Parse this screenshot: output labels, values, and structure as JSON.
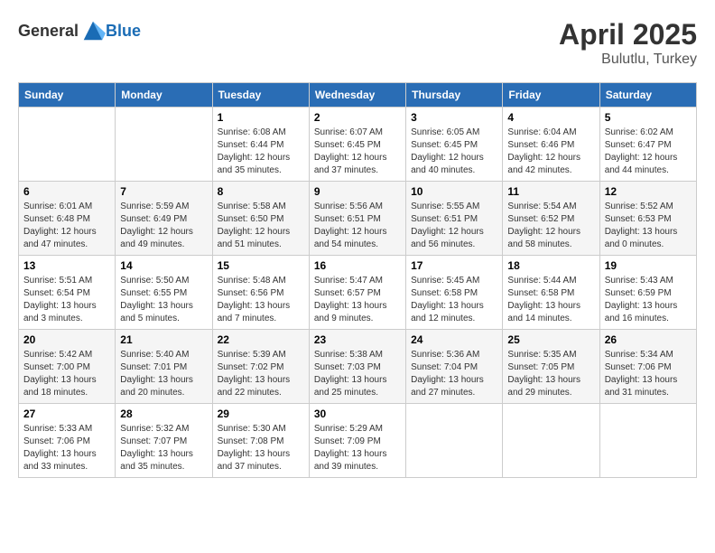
{
  "header": {
    "logo_general": "General",
    "logo_blue": "Blue",
    "title": "April 2025",
    "location": "Bulutlu, Turkey"
  },
  "days_of_week": [
    "Sunday",
    "Monday",
    "Tuesday",
    "Wednesday",
    "Thursday",
    "Friday",
    "Saturday"
  ],
  "weeks": [
    [
      {
        "num": "",
        "info": ""
      },
      {
        "num": "",
        "info": ""
      },
      {
        "num": "1",
        "info": "Sunrise: 6:08 AM\nSunset: 6:44 PM\nDaylight: 12 hours and 35 minutes."
      },
      {
        "num": "2",
        "info": "Sunrise: 6:07 AM\nSunset: 6:45 PM\nDaylight: 12 hours and 37 minutes."
      },
      {
        "num": "3",
        "info": "Sunrise: 6:05 AM\nSunset: 6:45 PM\nDaylight: 12 hours and 40 minutes."
      },
      {
        "num": "4",
        "info": "Sunrise: 6:04 AM\nSunset: 6:46 PM\nDaylight: 12 hours and 42 minutes."
      },
      {
        "num": "5",
        "info": "Sunrise: 6:02 AM\nSunset: 6:47 PM\nDaylight: 12 hours and 44 minutes."
      }
    ],
    [
      {
        "num": "6",
        "info": "Sunrise: 6:01 AM\nSunset: 6:48 PM\nDaylight: 12 hours and 47 minutes."
      },
      {
        "num": "7",
        "info": "Sunrise: 5:59 AM\nSunset: 6:49 PM\nDaylight: 12 hours and 49 minutes."
      },
      {
        "num": "8",
        "info": "Sunrise: 5:58 AM\nSunset: 6:50 PM\nDaylight: 12 hours and 51 minutes."
      },
      {
        "num": "9",
        "info": "Sunrise: 5:56 AM\nSunset: 6:51 PM\nDaylight: 12 hours and 54 minutes."
      },
      {
        "num": "10",
        "info": "Sunrise: 5:55 AM\nSunset: 6:51 PM\nDaylight: 12 hours and 56 minutes."
      },
      {
        "num": "11",
        "info": "Sunrise: 5:54 AM\nSunset: 6:52 PM\nDaylight: 12 hours and 58 minutes."
      },
      {
        "num": "12",
        "info": "Sunrise: 5:52 AM\nSunset: 6:53 PM\nDaylight: 13 hours and 0 minutes."
      }
    ],
    [
      {
        "num": "13",
        "info": "Sunrise: 5:51 AM\nSunset: 6:54 PM\nDaylight: 13 hours and 3 minutes."
      },
      {
        "num": "14",
        "info": "Sunrise: 5:50 AM\nSunset: 6:55 PM\nDaylight: 13 hours and 5 minutes."
      },
      {
        "num": "15",
        "info": "Sunrise: 5:48 AM\nSunset: 6:56 PM\nDaylight: 13 hours and 7 minutes."
      },
      {
        "num": "16",
        "info": "Sunrise: 5:47 AM\nSunset: 6:57 PM\nDaylight: 13 hours and 9 minutes."
      },
      {
        "num": "17",
        "info": "Sunrise: 5:45 AM\nSunset: 6:58 PM\nDaylight: 13 hours and 12 minutes."
      },
      {
        "num": "18",
        "info": "Sunrise: 5:44 AM\nSunset: 6:58 PM\nDaylight: 13 hours and 14 minutes."
      },
      {
        "num": "19",
        "info": "Sunrise: 5:43 AM\nSunset: 6:59 PM\nDaylight: 13 hours and 16 minutes."
      }
    ],
    [
      {
        "num": "20",
        "info": "Sunrise: 5:42 AM\nSunset: 7:00 PM\nDaylight: 13 hours and 18 minutes."
      },
      {
        "num": "21",
        "info": "Sunrise: 5:40 AM\nSunset: 7:01 PM\nDaylight: 13 hours and 20 minutes."
      },
      {
        "num": "22",
        "info": "Sunrise: 5:39 AM\nSunset: 7:02 PM\nDaylight: 13 hours and 22 minutes."
      },
      {
        "num": "23",
        "info": "Sunrise: 5:38 AM\nSunset: 7:03 PM\nDaylight: 13 hours and 25 minutes."
      },
      {
        "num": "24",
        "info": "Sunrise: 5:36 AM\nSunset: 7:04 PM\nDaylight: 13 hours and 27 minutes."
      },
      {
        "num": "25",
        "info": "Sunrise: 5:35 AM\nSunset: 7:05 PM\nDaylight: 13 hours and 29 minutes."
      },
      {
        "num": "26",
        "info": "Sunrise: 5:34 AM\nSunset: 7:06 PM\nDaylight: 13 hours and 31 minutes."
      }
    ],
    [
      {
        "num": "27",
        "info": "Sunrise: 5:33 AM\nSunset: 7:06 PM\nDaylight: 13 hours and 33 minutes."
      },
      {
        "num": "28",
        "info": "Sunrise: 5:32 AM\nSunset: 7:07 PM\nDaylight: 13 hours and 35 minutes."
      },
      {
        "num": "29",
        "info": "Sunrise: 5:30 AM\nSunset: 7:08 PM\nDaylight: 13 hours and 37 minutes."
      },
      {
        "num": "30",
        "info": "Sunrise: 5:29 AM\nSunset: 7:09 PM\nDaylight: 13 hours and 39 minutes."
      },
      {
        "num": "",
        "info": ""
      },
      {
        "num": "",
        "info": ""
      },
      {
        "num": "",
        "info": ""
      }
    ]
  ]
}
